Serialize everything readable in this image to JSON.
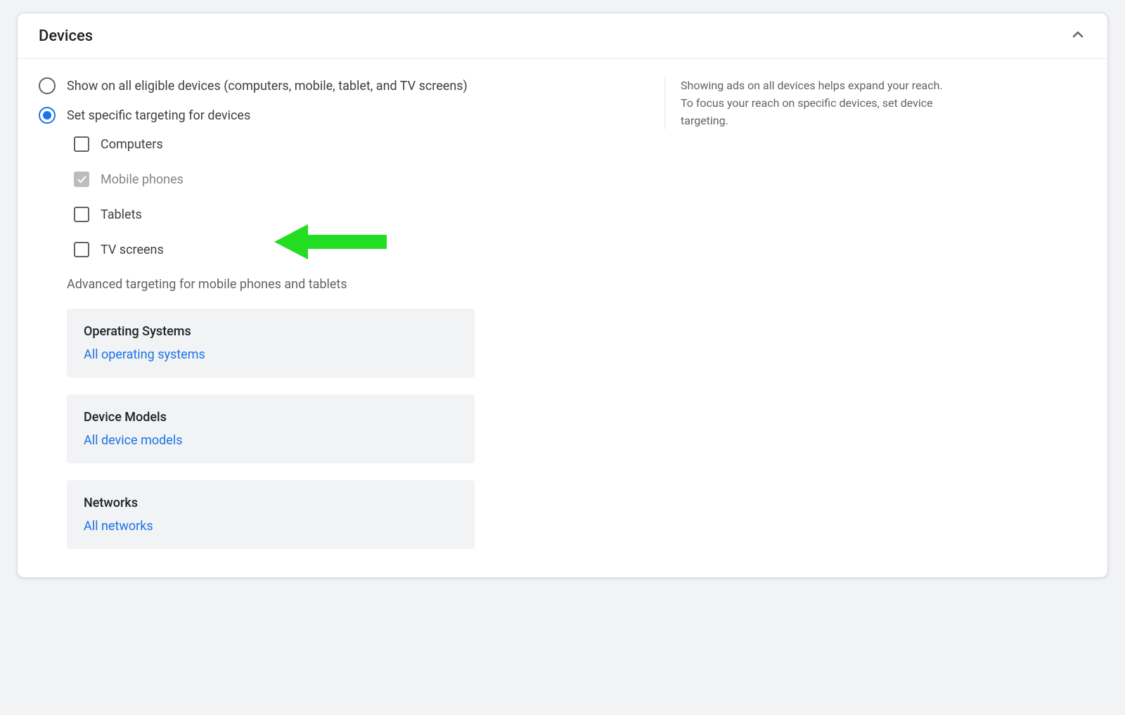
{
  "section": {
    "title": "Devices"
  },
  "radios": {
    "all": "Show on all eligible devices (computers, mobile, tablet, and TV screens)",
    "specific": "Set specific targeting for devices"
  },
  "devices": {
    "computers": "Computers",
    "mobile": "Mobile phones",
    "tablets": "Tablets",
    "tv": "TV screens"
  },
  "advanced_heading": "Advanced targeting for mobile phones and tablets",
  "advanced": {
    "os": {
      "title": "Operating Systems",
      "link": "All operating systems"
    },
    "models": {
      "title": "Device Models",
      "link": "All device models"
    },
    "networks": {
      "title": "Networks",
      "link": "All networks"
    }
  },
  "help": "Showing ads on all devices helps expand your reach. To focus your reach on specific devices, set device targeting.",
  "colors": {
    "accent": "#1a73e8",
    "arrow": "#2ecc40"
  }
}
